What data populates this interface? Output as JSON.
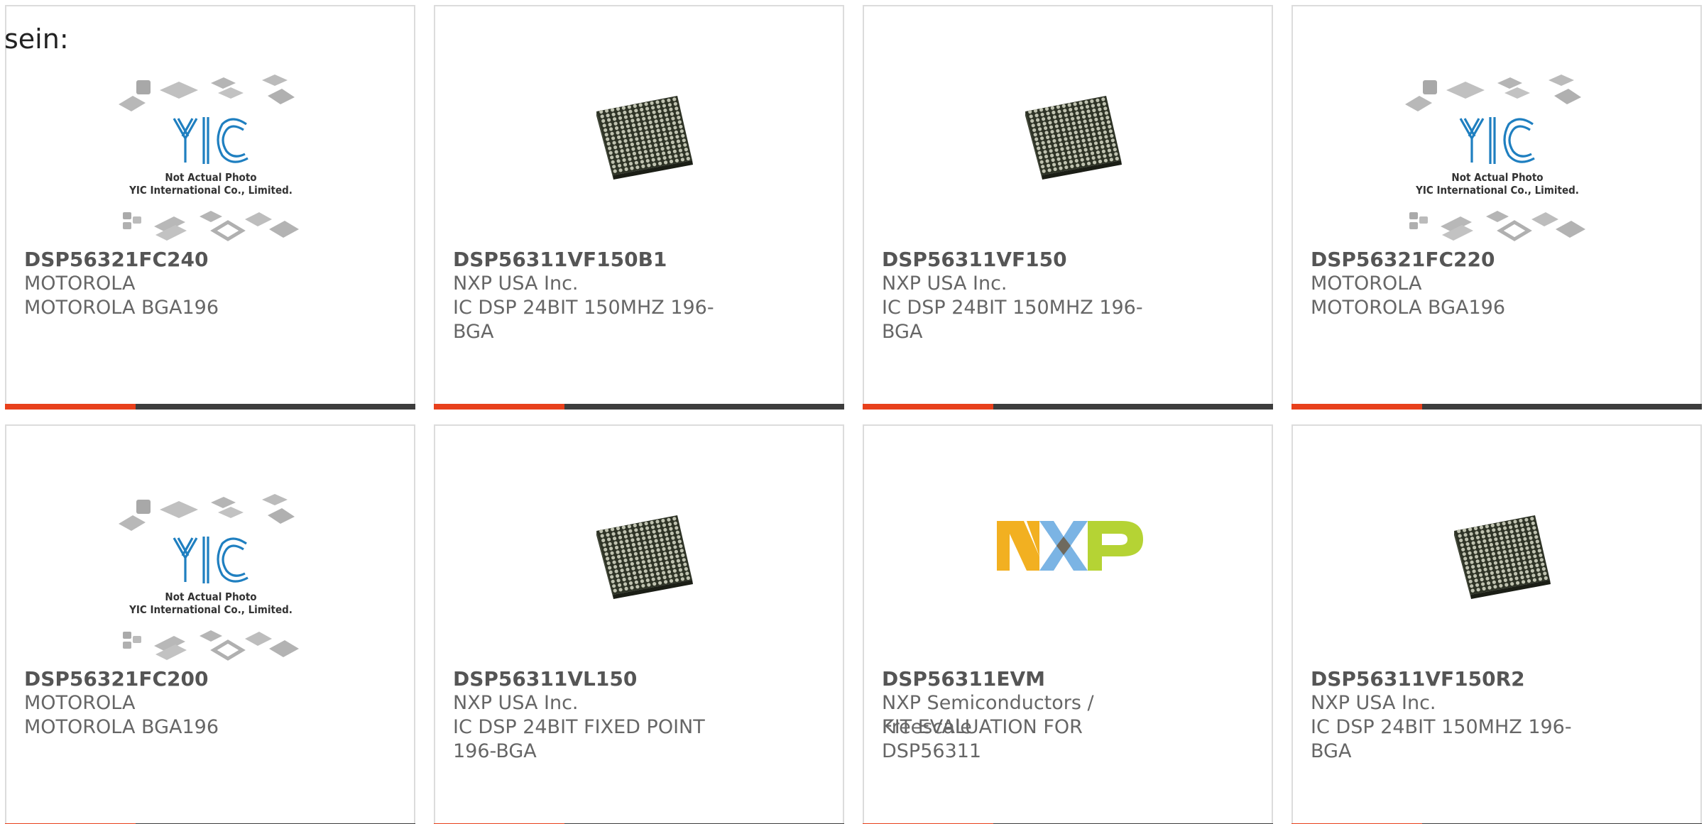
{
  "intro": "sein:",
  "accent_color": "#e8401c",
  "bar_color": "#3d3d3d",
  "yic_placeholder": {
    "line1": "Not Actual Photo",
    "line2": "YIC International Co., Limited."
  },
  "products": [
    {
      "part": "DSP56321FC240",
      "manufacturer": "MOTOROLA",
      "description": "MOTOROLA BGA196",
      "image": "yic-placeholder"
    },
    {
      "part": "DSP56311VF150B1",
      "manufacturer": "NXP USA Inc.",
      "description": "IC DSP 24BIT 150MHZ 196-BGA",
      "image": "bga-chip"
    },
    {
      "part": "DSP56311VF150",
      "manufacturer": "NXP USA Inc.",
      "description": "IC DSP 24BIT 150MHZ 196-BGA",
      "image": "bga-chip"
    },
    {
      "part": "DSP56321FC220",
      "manufacturer": "MOTOROLA",
      "description": "MOTOROLA BGA196",
      "image": "yic-placeholder"
    },
    {
      "part": "DSP56321FC200",
      "manufacturer": "MOTOROLA",
      "description": "MOTOROLA BGA196",
      "image": "yic-placeholder"
    },
    {
      "part": "DSP56311VL150",
      "manufacturer": "NXP USA Inc.",
      "description": "IC DSP 24BIT FIXED POINT 196-BGA",
      "image": "bga-chip"
    },
    {
      "part": "DSP56311EVM",
      "manufacturer": "NXP Semiconductors / Freescale",
      "description": "KIT EVALUATION FOR DSP56311",
      "image": "nxp-logo"
    },
    {
      "part": "DSP56311VF150R2",
      "manufacturer": "NXP USA Inc.",
      "description": "IC DSP 24BIT 150MHZ 196-BGA",
      "image": "bga-chip"
    }
  ]
}
